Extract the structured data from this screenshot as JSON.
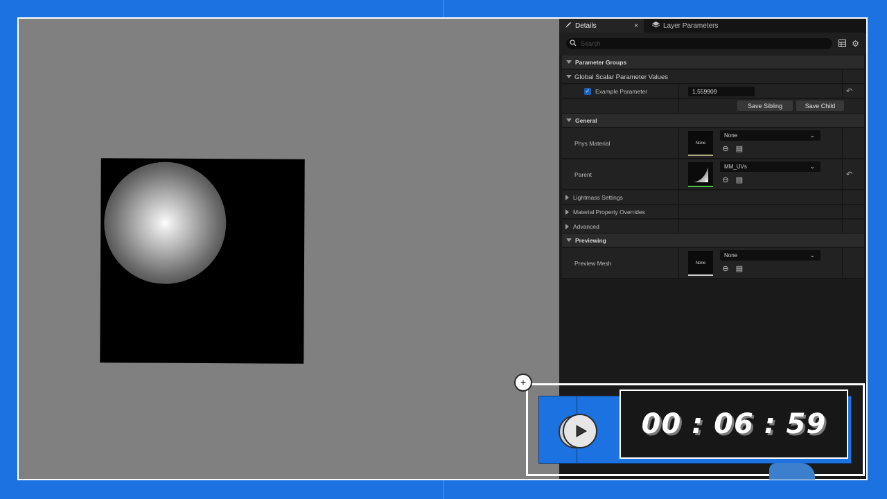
{
  "details_panel": {
    "tabs": [
      {
        "label": "Details",
        "icon": "brush-icon",
        "close": "×"
      },
      {
        "label": "Layer Parameters",
        "icon": "layers-icon"
      }
    ],
    "search_placeholder": "Search",
    "sections": {
      "parameter_groups": "Parameter Groups",
      "global_scalar": "Global Scalar Parameter Values",
      "general": "General",
      "lightmass": "Lightmass Settings",
      "material_overrides": "Material Property Overrides",
      "advanced": "Advanced",
      "previewing": "Previewing"
    },
    "example_param": {
      "label": "Example Parameter",
      "value": "1,559909",
      "checked": true
    },
    "buttons": {
      "save_sibling": "Save Sibling",
      "save_child": "Save Child"
    },
    "phys_material": {
      "label": "Phys Material",
      "thumb": "None",
      "value": "None"
    },
    "parent": {
      "label": "Parent",
      "value": "MM_UVs"
    },
    "preview_mesh": {
      "label": "Preview Mesh",
      "thumb": "None",
      "value": "None"
    }
  },
  "timer": {
    "display": "00 : 06 : 59"
  },
  "colors": {
    "accent_blue": "#1b72e0",
    "panel_bg": "#1a1a1a",
    "viewport_gray": "#808080"
  }
}
